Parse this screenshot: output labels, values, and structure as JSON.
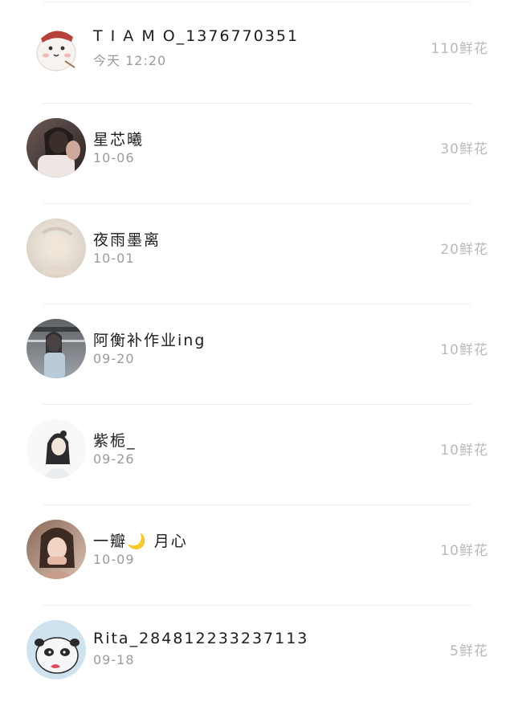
{
  "items": [
    {
      "name": "T I A M O_1376770351",
      "date": "今天 12:20",
      "flowers": "110鲜花",
      "avatar": "panda-cartoon"
    },
    {
      "name": "星芯曦",
      "date": "10-06",
      "flowers": "30鲜花",
      "avatar": "photo"
    },
    {
      "name": "夜雨墨离",
      "date": "10-01",
      "flowers": "20鲜花",
      "avatar": "photo"
    },
    {
      "name": "阿衡补作业ing",
      "date": "09-20",
      "flowers": "10鲜花",
      "avatar": "photo"
    },
    {
      "name": "紫栀_",
      "date": "09-26",
      "flowers": "10鲜花",
      "avatar": "illustration"
    },
    {
      "name": "一瓣🌙 月心",
      "date": "10-09",
      "flowers": "10鲜花",
      "avatar": "photo"
    },
    {
      "name": "Rita_284812233237113",
      "date": "09-18",
      "flowers": "5鲜花",
      "avatar": "panda-cartoon"
    }
  ]
}
